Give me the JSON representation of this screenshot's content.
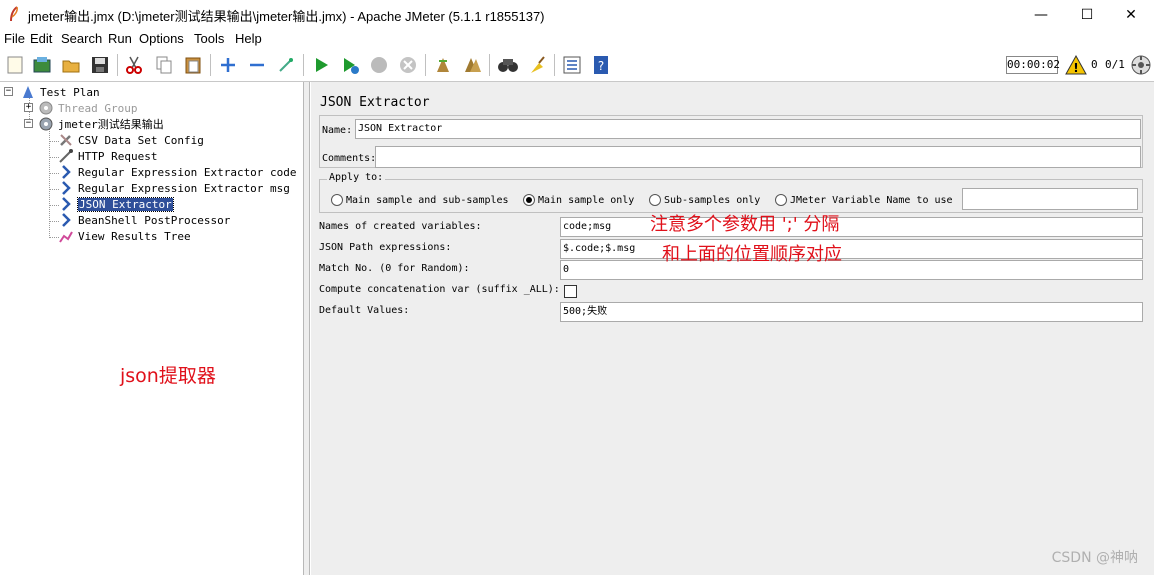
{
  "window": {
    "title": "jmeter输出.jmx (D:\\jmeter测试结果输出\\jmeter输出.jmx) - Apache JMeter (5.1.1 r1855137)",
    "minimize": "—",
    "maximize": "☐",
    "close": "✕"
  },
  "menu": [
    "File",
    "Edit",
    "Search",
    "Run",
    "Options",
    "Tools",
    "Help"
  ],
  "toolbar": {
    "timer": "00:00:02",
    "warning_count": "0",
    "threads": "0/1"
  },
  "tree": {
    "items": [
      {
        "label": "Test Plan"
      },
      {
        "label": "Thread Group"
      },
      {
        "label": "jmeter测试结果输出"
      },
      {
        "label": "CSV Data Set Config"
      },
      {
        "label": "HTTP Request"
      },
      {
        "label": "Regular Expression Extractor code"
      },
      {
        "label": "Regular Expression Extractor msg"
      },
      {
        "label": "JSON Extractor"
      },
      {
        "label": "BeanShell PostProcessor"
      },
      {
        "label": "View Results Tree"
      }
    ],
    "annotation": "json提取器"
  },
  "panel": {
    "title": "JSON Extractor",
    "name_label": "Name:",
    "name_value": "JSON Extractor",
    "comments_label": "Comments:",
    "comments_value": "",
    "apply_to": {
      "legend": "Apply to:",
      "options": [
        "Main sample and sub-samples",
        "Main sample only",
        "Sub-samples only",
        "JMeter Variable Name to use"
      ],
      "selected": "Main sample only",
      "variable_value": ""
    },
    "fields": {
      "names_label": "Names of created variables:",
      "names_value": "code;msg",
      "paths_label": "JSON Path expressions:",
      "paths_value": "$.code;$.msg",
      "match_label": "Match No. (0 for Random):",
      "match_value": "0",
      "concat_label": "Compute concatenation var (suffix _ALL):",
      "concat_checked": false,
      "default_label": "Default Values:",
      "default_value": "500;失败"
    },
    "annotation_line1": "注意多个参数用 ';' 分隔",
    "annotation_line2": "和上面的位置顺序对应"
  },
  "watermark": "CSDN @神呐"
}
